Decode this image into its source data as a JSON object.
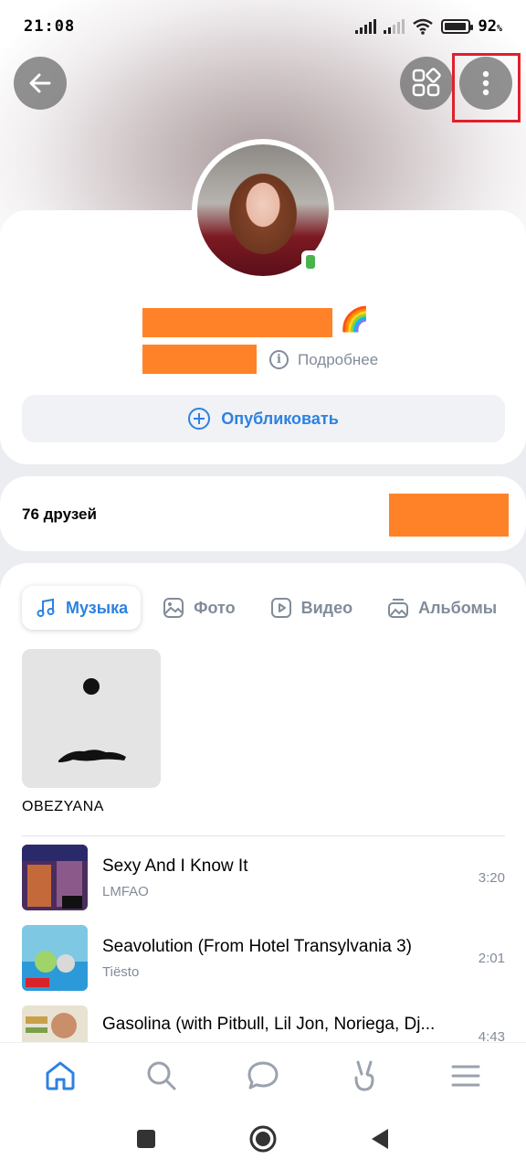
{
  "status_bar": {
    "time": "21:08",
    "battery_percent": "92",
    "battery_unit": "%"
  },
  "header": {
    "back_icon": "arrow-left-icon",
    "apps_icon": "apps-grid-icon",
    "more_icon": "more-vertical-icon"
  },
  "profile": {
    "name_emoji": "🌈",
    "details_label": "Подробнее",
    "publish_label": "Опубликовать"
  },
  "friends": {
    "label": "76 друзей"
  },
  "media_tabs": [
    {
      "label": "Музыка",
      "icon": "music-note-icon",
      "active": true
    },
    {
      "label": "Фото",
      "icon": "photo-icon",
      "active": false
    },
    {
      "label": "Видео",
      "icon": "video-icon",
      "active": false
    },
    {
      "label": "Альбомы",
      "icon": "albums-icon",
      "active": false
    }
  ],
  "album": {
    "title": "OBEZYANA"
  },
  "tracks": [
    {
      "title": "Sexy And I Know It",
      "artist": "LMFAO",
      "duration": "3:20"
    },
    {
      "title": "Seavolution (From Hotel Transylvania 3)",
      "artist": "Tiësto",
      "duration": "2:01"
    },
    {
      "title": "Gasolina (with Pitbull, Lil Jon, Noriega, Dj...",
      "artist": "",
      "duration": "4:43"
    }
  ],
  "bottom_nav": [
    "home-icon",
    "search-icon",
    "messages-icon",
    "clips-icon",
    "menu-icon"
  ],
  "system_nav": [
    "recents-icon",
    "home-circle-icon",
    "back-triangle-icon"
  ],
  "colors": {
    "accent": "#2d81e0",
    "redaction": "#ff8228",
    "highlight": "#e0202a",
    "online": "#4bb34b"
  }
}
